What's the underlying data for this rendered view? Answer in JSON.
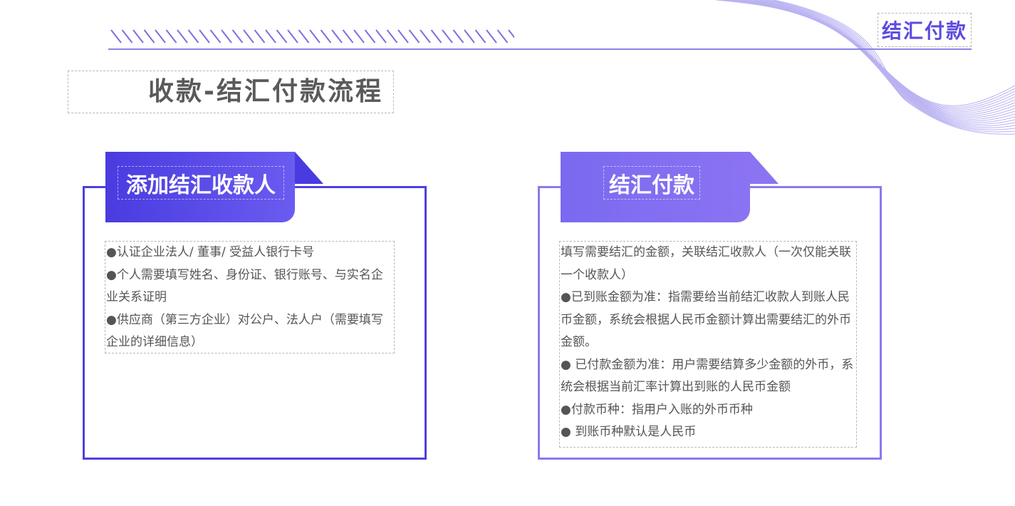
{
  "header": {
    "title": "结汇付款",
    "accent_color": "#5b4be0",
    "line_color": "#8a85e6"
  },
  "page": {
    "title": "收款-结汇付款流程"
  },
  "cards": [
    {
      "tab_label": "添加结汇收款人",
      "color": "#4f3fe0",
      "lines": [
        "●认证企业法人/ 董事/ 受益人银行卡号",
        "●个人需要填写姓名、身份证、银行账号、与实名企业关系证明",
        "●供应商（第三方企业）对公户、法人户（需要填写企业的详细信息）"
      ]
    },
    {
      "tab_label": "结汇付款",
      "color": "#8e78ee",
      "lines": [
        "填写需要结汇的金额，关联结汇收款人（一次仅能关联一个收款人）",
        "●已到账金额为准：指需要给当前结汇收款人到账人民币金额，系统会根据人民币金额计算出需要结汇的外币金额。",
        "● 已付款金额为准：用户需要结算多少金额的外币，系统会根据当前汇率计算出到账的人民币金额",
        "●付款币种：指用户入账的外币币种",
        "● 到账币种默认是人民币"
      ]
    }
  ]
}
